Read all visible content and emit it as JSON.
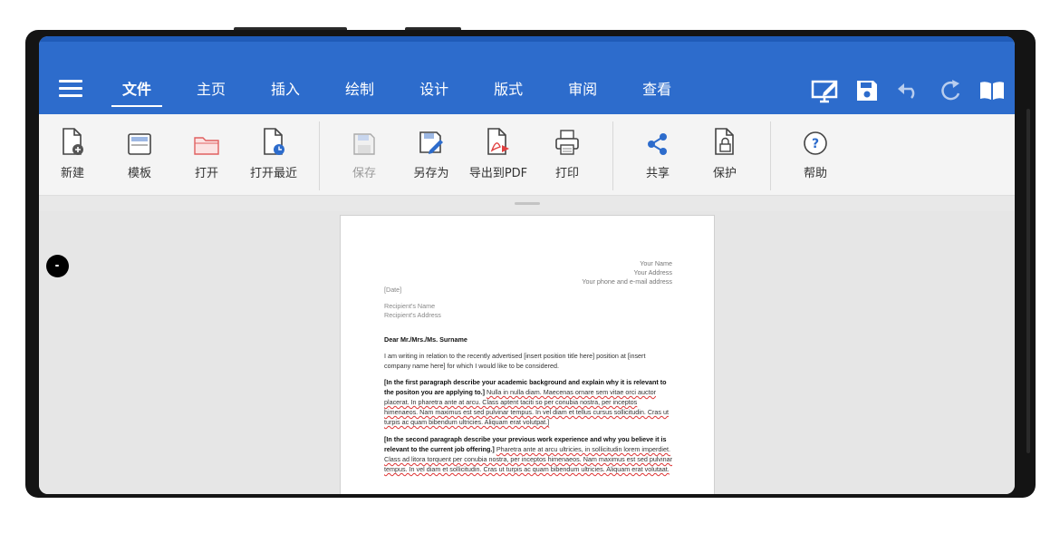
{
  "app": {
    "tabs": [
      "文件",
      "主页",
      "插入",
      "绘制",
      "设计",
      "版式",
      "审阅",
      "查看"
    ],
    "active_tab": "文件",
    "accent_color": "#2d6ccc"
  },
  "appbar_icons": [
    "fullscreen-edit-icon",
    "save-icon",
    "undo-icon",
    "redo-icon",
    "reading-mode-icon"
  ],
  "ribbon": {
    "new": "新建",
    "template": "模板",
    "open": "打开",
    "open_recent": "打开最近",
    "save": "保存",
    "save_as": "另存为",
    "export_pdf": "导出到PDF",
    "print": "打印",
    "share": "共享",
    "protect": "保护",
    "help": "帮助"
  },
  "document": {
    "sender_name": "Your Name",
    "sender_address": "Your Address",
    "sender_contact": "Your phone and e-mail address",
    "date": "[Date]",
    "recipient_name": "Recipient's Name",
    "recipient_address": "Recipient's Address",
    "salutation": "Dear Mr./Mrs./Ms. Surname",
    "intro": "I am writing in relation to the recently advertised [insert position title here] position at [insert company name here] for which I would like to be considered.",
    "p1_bold": "[In the first paragraph describe your academic background and explain why it is relevant to the positon you are applying to.]",
    "p1_body": "Nulla in nulla diam. Maecenas ornare sem vitae orci auctor placerat. In pharetra ante at arcu. Class aptent taciti so per conubia nostra, per inceptos himenaeos. Nam maximus est sed pulvinar tempus. In vel diam et tellus cursus sollicitudin. Cras ut turpis ac quam bibendum ultricies. Aliquam erat volutpat.]",
    "p2_bold": "[In the second paragraph describe your previous work experience and why you believe it is relevant to the current job offering.]",
    "p2_body": "Pharetra ante at arcu ultricies, in sollicitudin lorem imperdiet. Class ad litora torquent per conubia nostra, per inceptos himenaeos. Nam maximus est sed pulvinar tempus. In vel diam et sollicitudin. Cras ut turpis ac quam bibendum ultricies. Aliquam erat volutaat."
  }
}
